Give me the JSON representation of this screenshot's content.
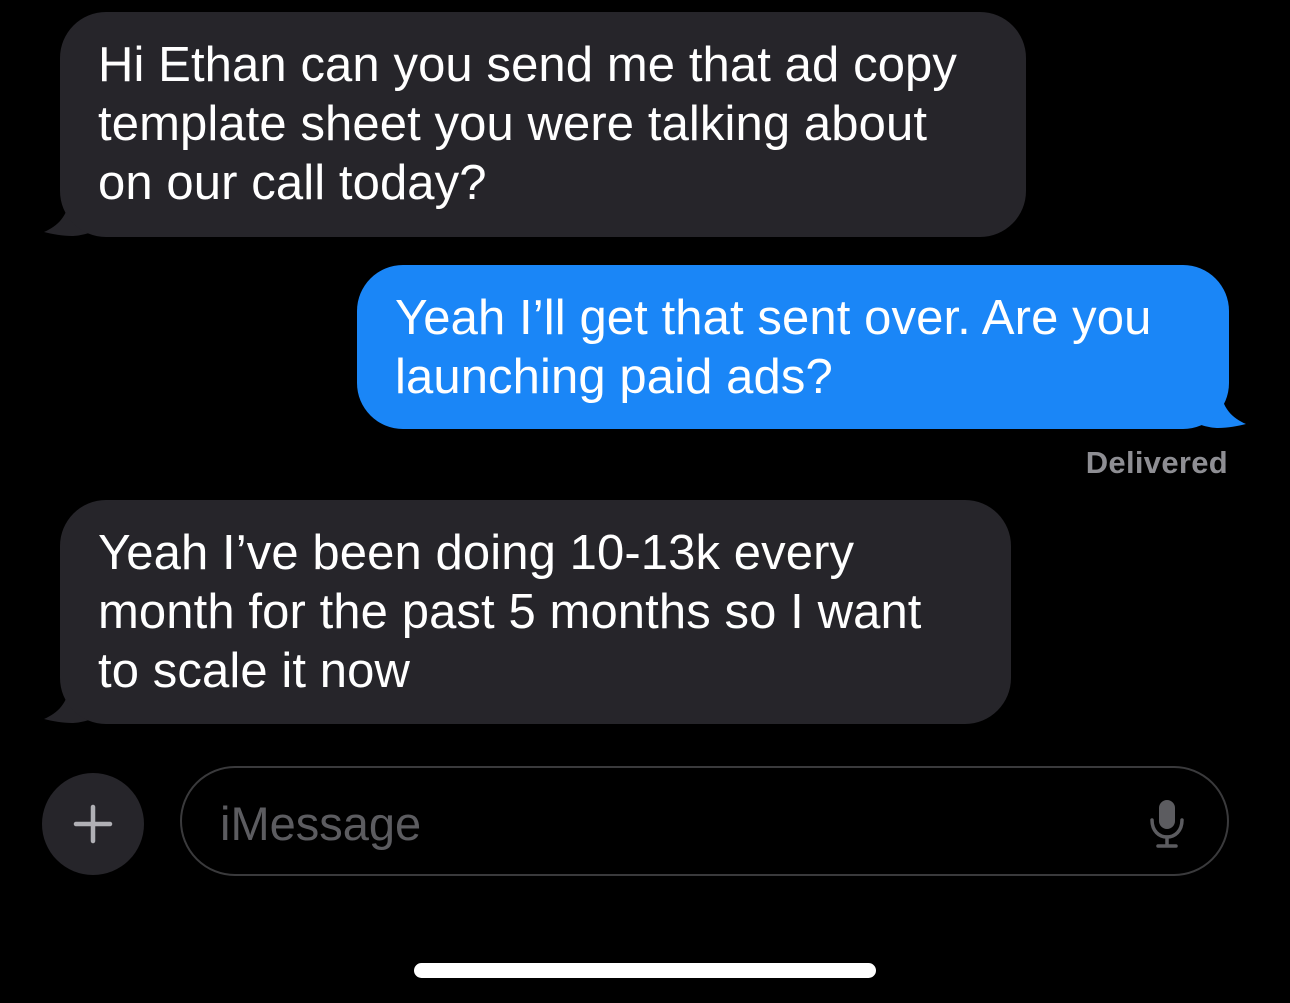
{
  "conversation": {
    "messages": [
      {
        "direction": "incoming",
        "text": "Hi Ethan can you send me that ad copy template sheet you were talking about on our call today?"
      },
      {
        "direction": "outgoing",
        "text": "Yeah I’ll get that sent over. Are you launching paid ads?"
      },
      {
        "direction": "incoming",
        "text": "Yeah I’ve been doing 10-13k every month for the past 5 months so I want to scale it now"
      }
    ],
    "delivery_status": "Delivered"
  },
  "composer": {
    "placeholder": "iMessage",
    "plus_icon": "plus-icon",
    "mic_icon": "microphone-icon"
  },
  "colors": {
    "incoming_bubble": "#26252a",
    "outgoing_bubble": "#1a86f7",
    "background": "#000000",
    "status_text": "#8e8e93",
    "placeholder_text": "#5c5c60"
  }
}
